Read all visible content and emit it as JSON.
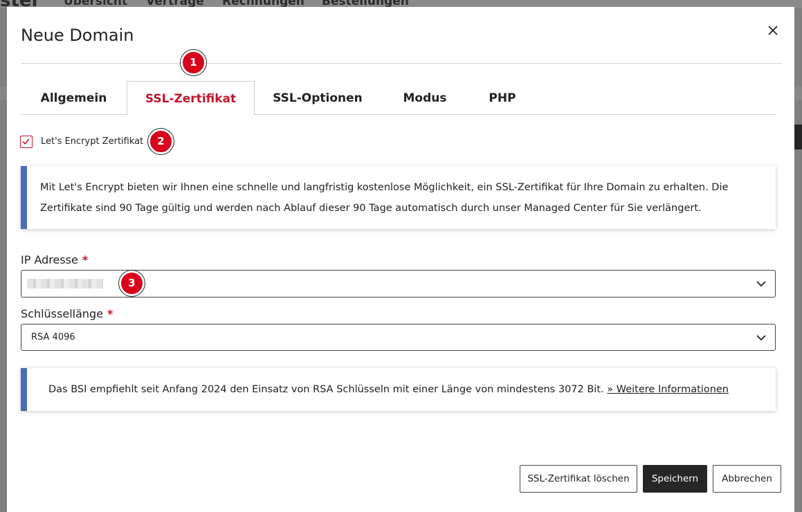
{
  "background": {
    "nav_items": [
      "Übersicht",
      "Verträge",
      "Rechnungen",
      "Bestellungen"
    ]
  },
  "modal": {
    "title": "Neue Domain",
    "close_icon": "close-icon"
  },
  "badges": [
    "1",
    "2",
    "3"
  ],
  "tabs": [
    {
      "label": "Allgemein",
      "active": false
    },
    {
      "label": "SSL-Zertifikat",
      "active": true
    },
    {
      "label": "SSL-Optionen",
      "active": false
    },
    {
      "label": "Modus",
      "active": false
    },
    {
      "label": "PHP",
      "active": false
    }
  ],
  "letsencrypt": {
    "label": "Let's Encrypt Zertifikat",
    "checked": true
  },
  "info_letsencrypt": "Mit Let's Encrypt bieten wir Ihnen eine schnelle und langfristig kostenlose Möglichkeit, ein SSL-Zertifikat für Ihre Domain zu erhalten. Die Zertifikate sind 90 Tage gültig und werden nach Ablauf dieser 90 Tage automatisch durch unser Managed Center für Sie verlängert.",
  "ip_field": {
    "label": "IP Adresse",
    "required_mark": "*",
    "value": ""
  },
  "key_field": {
    "label": "Schlüssellänge",
    "required_mark": "*",
    "value": "RSA 4096"
  },
  "info_bsi": {
    "text": "Das BSI empfiehlt seit Anfang 2024 den Einsatz von RSA Schlüsseln mit einer Länge von mindestens 3072 Bit. ",
    "link": "» Weitere Informationen"
  },
  "buttons": {
    "delete": "SSL-Zertifikat löschen",
    "save": "Speichern",
    "cancel": "Abbrechen"
  },
  "colors": {
    "accent": "#c0152c",
    "badge": "#d9041c",
    "info_border": "#4a6eb6",
    "primary_button": "#262626"
  }
}
